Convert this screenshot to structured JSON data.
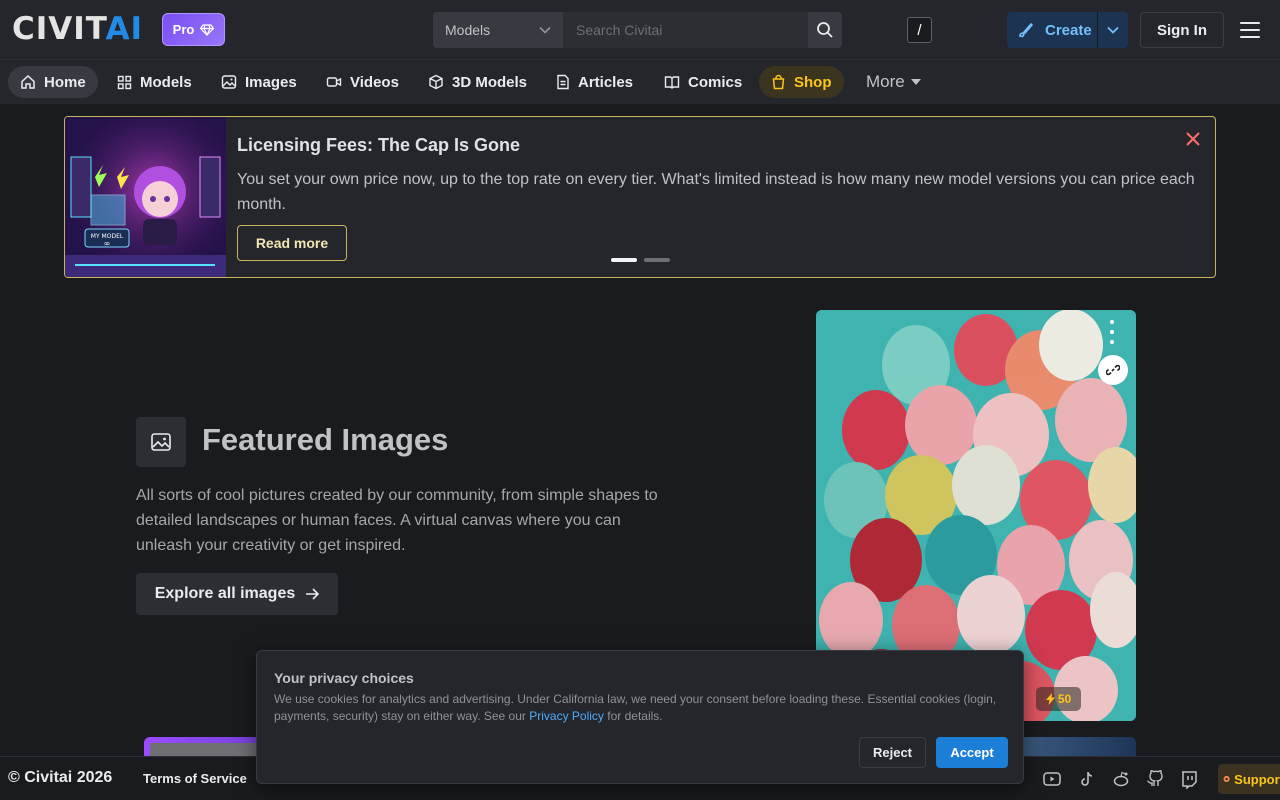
{
  "header": {
    "logo_part1": "CIVIT",
    "logo_part2": "AI",
    "pro_label": "Pro",
    "search_category": "Models",
    "search_placeholder": "Search Civitai",
    "search_shortcut": "/",
    "create_label": "Create",
    "signin_label": "Sign In"
  },
  "nav": {
    "items": [
      {
        "label": "Home",
        "icon": "home-icon"
      },
      {
        "label": "Models",
        "icon": "grid-icon"
      },
      {
        "label": "Images",
        "icon": "photo-icon"
      },
      {
        "label": "Videos",
        "icon": "video-icon"
      },
      {
        "label": "3D Models",
        "icon": "cube-icon"
      },
      {
        "label": "Articles",
        "icon": "file-icon"
      },
      {
        "label": "Comics",
        "icon": "book-icon"
      },
      {
        "label": "Shop",
        "icon": "shopping-bag-icon"
      }
    ],
    "more_label": "More"
  },
  "banner": {
    "title": "Licensing Fees: The Cap Is Gone",
    "body": "You set your own price now, up to the top rate on every tier. What's limited instead is how many new model versions you can price each month.",
    "button_label": "Read more",
    "image_text_1": "MY MODEL",
    "image_text_2": "∞"
  },
  "featured": {
    "title": "Featured Images",
    "description": "All sorts of cool pictures created by our community, from simple shapes to detailed landscapes or human faces. A virtual canvas where you can unleash your creativity or get inspired.",
    "button_label": "Explore all images",
    "buzz_count": "50"
  },
  "privacy": {
    "title": "Your privacy choices",
    "text_before": "We use cookies for analytics and advertising. Under California law, we need your consent before loading these. Essential cookies (login, payments, security) stay on either way. See our",
    "link_label": "Privacy Policy",
    "text_after": "for details.",
    "reject_label": "Reject",
    "accept_label": "Accept"
  },
  "footer": {
    "copyright": "© Civitai 2026",
    "terms_label": "Terms of Service",
    "support_label": "Support"
  },
  "colors": {
    "accent": "#228be6",
    "shop": "#fcc419",
    "banner_border": "#c9b458",
    "accept": "#1c7ed6"
  }
}
